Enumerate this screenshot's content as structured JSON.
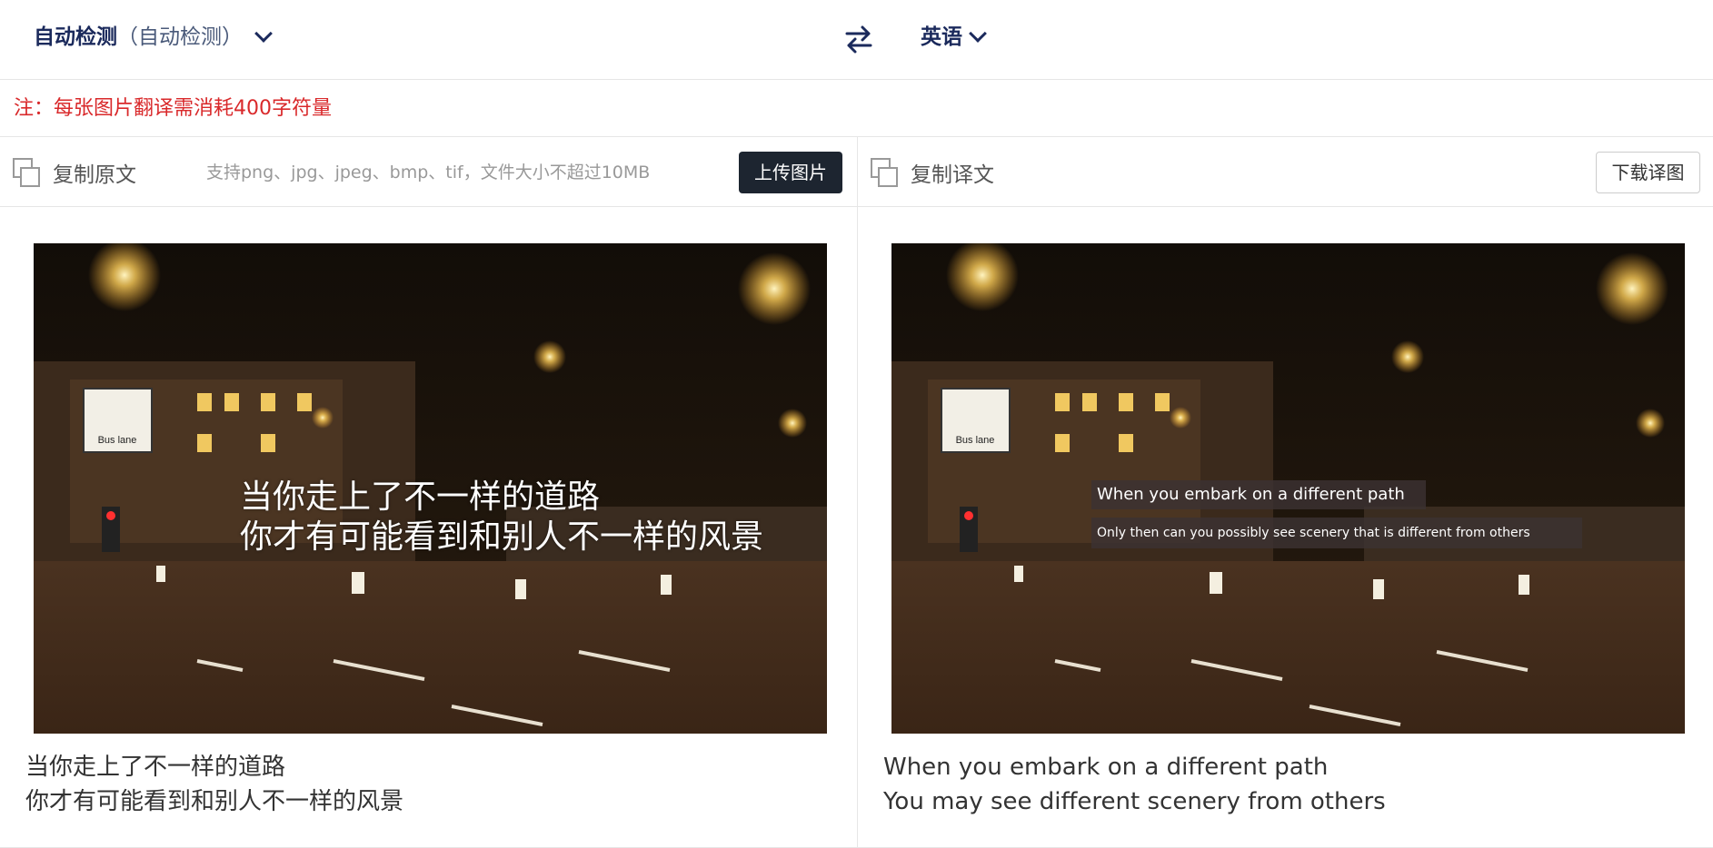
{
  "header": {
    "source_lang_main": "自动检测",
    "source_lang_sub": "（自动检测）",
    "target_lang": "英语"
  },
  "notice": "注：每张图片翻译需消耗400字符量",
  "left_panel": {
    "copy_label": "复制原文",
    "hint": "支持png、jpg、jpeg、bmp、tif，文件大小不超过10MB",
    "upload_label": "上传图片",
    "image_text": [
      "当你走上了不一样的道路",
      "你才有可能看到和别人不一样的风景"
    ],
    "sign_text": "Bus lane",
    "result_lines": [
      "当你走上了不一样的道路",
      "你才有可能看到和别人不一样的风景"
    ]
  },
  "right_panel": {
    "copy_label": "复制译文",
    "download_label": "下载译图",
    "image_text": [
      "When you embark on a different path",
      "Only then can you possibly see scenery that is different from others"
    ],
    "sign_text": "Bus lane",
    "result_lines": [
      "When you embark on a different path",
      "You may see different scenery from others"
    ]
  },
  "icons": {
    "swap": "swap-arrows-icon",
    "copy": "copy-icon",
    "chevron": "chevron-down-icon"
  },
  "colors": {
    "brand_dark": "#1b2a5c",
    "notice_red": "#d9292b",
    "upload_button": "#1d2530"
  }
}
